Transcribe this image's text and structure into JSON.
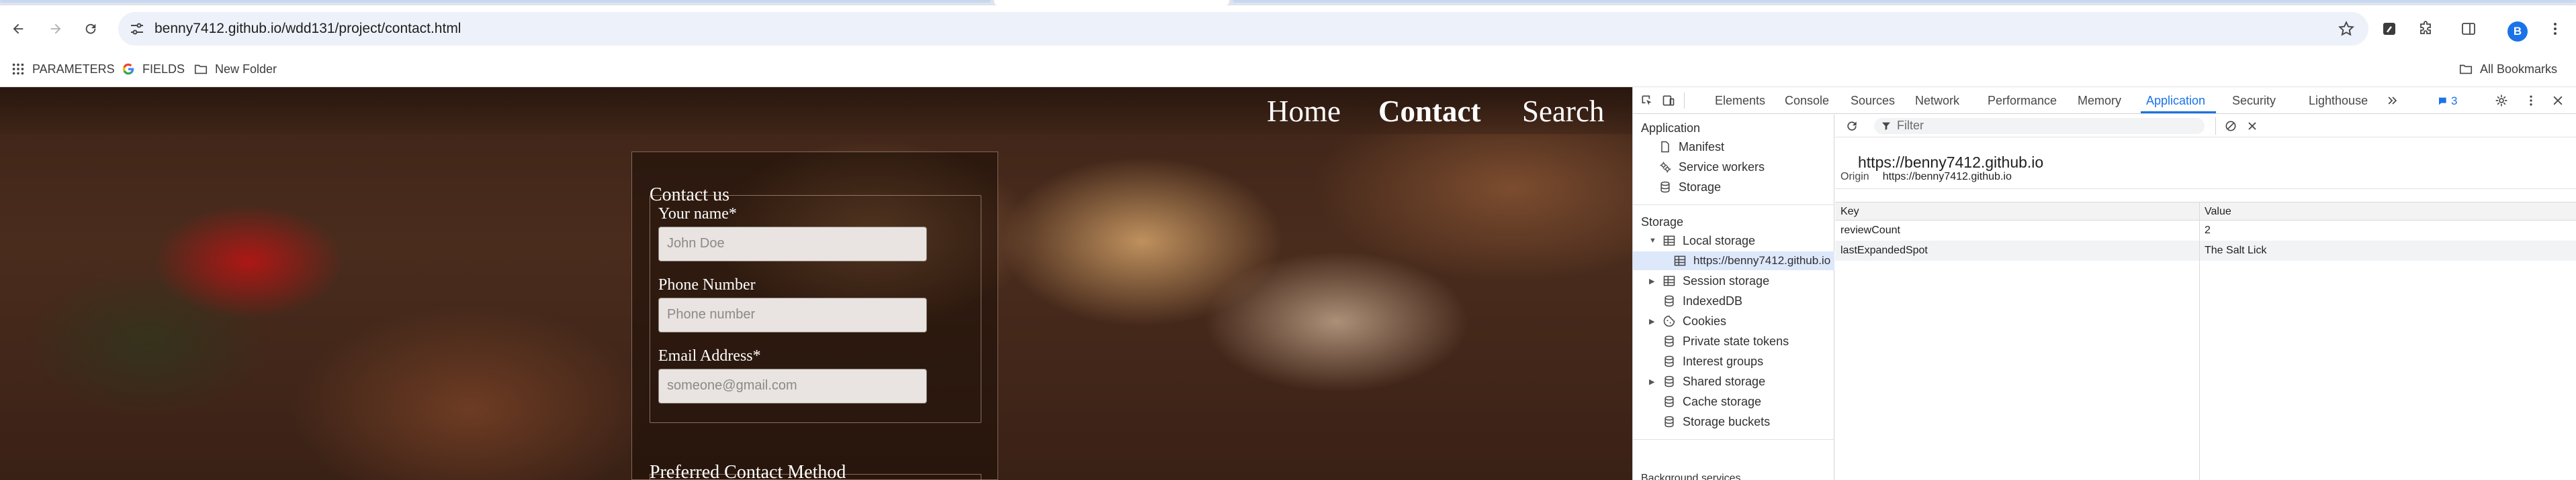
{
  "browser": {
    "url": "benny7412.github.io/wdd131/project/contact.html",
    "profile_initial": "B",
    "bookmarks": [
      {
        "label": "PARAMETERS",
        "icon": "apps-grid-icon"
      },
      {
        "label": "FIELDS",
        "icon": "google-g-icon"
      },
      {
        "label": "New Folder",
        "icon": "folder-icon"
      }
    ],
    "all_bookmarks_label": "All Bookmarks"
  },
  "page": {
    "nav": [
      "Home",
      "Contact",
      "Search"
    ],
    "current_nav": "Contact",
    "form": {
      "legend": "Contact us",
      "name_label": "Your name*",
      "name_placeholder": "John Doe",
      "phone_label": "Phone Number",
      "phone_placeholder": "Phone number",
      "email_label": "Email Address*",
      "email_placeholder": "someone@gmail.com",
      "method_legend": "Preferred Contact Method"
    }
  },
  "devtools": {
    "tabs": [
      "Elements",
      "Console",
      "Sources",
      "Network",
      "Performance",
      "Memory",
      "Application",
      "Security",
      "Lighthouse"
    ],
    "active_tab": "Application",
    "issues_count": "3",
    "sidebar": {
      "application_header": "Application",
      "application_items": [
        "Manifest",
        "Service workers",
        "Storage"
      ],
      "storage_header": "Storage",
      "storage_items": {
        "local_storage": "Local storage",
        "local_origin": "https://benny7412.github.io",
        "session_storage": "Session storage",
        "indexeddb": "IndexedDB",
        "cookies": "Cookies",
        "private_state_tokens": "Private state tokens",
        "interest_groups": "Interest groups",
        "shared_storage": "Shared storage",
        "cache_storage": "Cache storage",
        "storage_buckets": "Storage buckets"
      },
      "background_header": "Background services"
    },
    "main": {
      "filter_placeholder": "Filter",
      "origin_title": "https://benny7412.github.io",
      "origin_label": "Origin",
      "origin_value": "https://benny7412.github.io",
      "columns": [
        "Key",
        "Value"
      ],
      "rows": [
        {
          "key": "reviewCount",
          "value": "2"
        },
        {
          "key": "lastExpandedSpot",
          "value": "The Salt Lick"
        }
      ]
    }
  }
}
